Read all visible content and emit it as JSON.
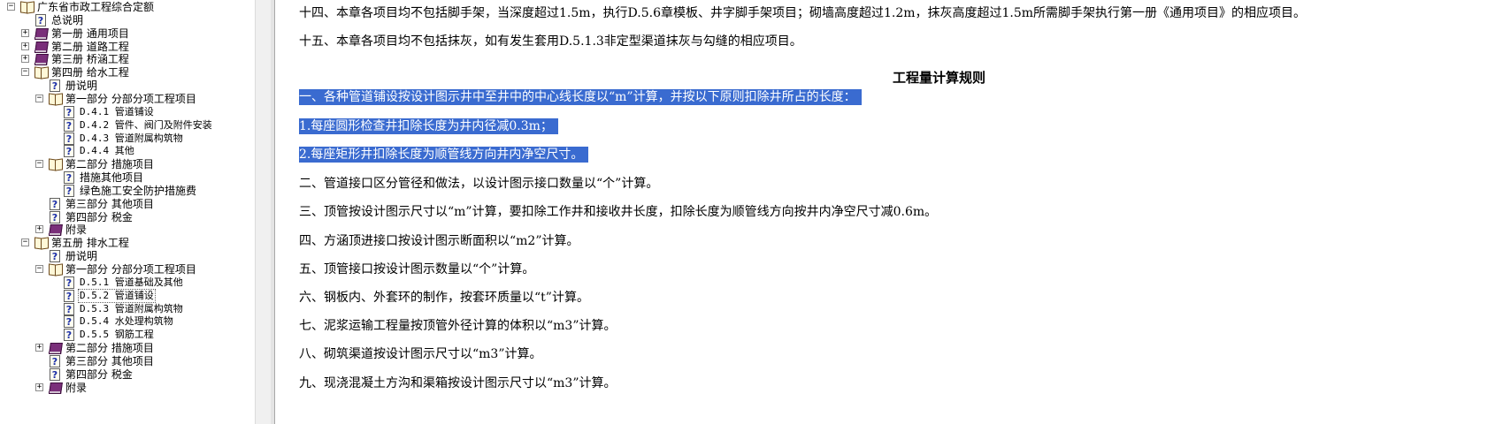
{
  "tree": {
    "items": [
      {
        "label": "广东省市政工程综合定额",
        "icon": "book-open-icon",
        "level": 0,
        "expander": "minus"
      },
      {
        "label": "总说明",
        "icon": "help-page-icon",
        "level": 1,
        "expander": ""
      },
      {
        "label": "第一册 通用项目",
        "icon": "book-closed-icon",
        "level": 1,
        "expander": "plus"
      },
      {
        "label": "第二册 道路工程",
        "icon": "book-closed-icon",
        "level": 1,
        "expander": "plus"
      },
      {
        "label": "第三册 桥涵工程",
        "icon": "book-closed-icon",
        "level": 1,
        "expander": "plus"
      },
      {
        "label": "第四册 给水工程",
        "icon": "book-open-icon",
        "level": 1,
        "expander": "minus"
      },
      {
        "label": "册说明",
        "icon": "help-page-icon",
        "level": 2,
        "expander": ""
      },
      {
        "label": "第一部分 分部分项工程项目",
        "icon": "book-open-icon",
        "level": 2,
        "expander": "minus"
      },
      {
        "label": "D.4.1 管道铺设",
        "icon": "help-page-icon",
        "level": 3,
        "expander": ""
      },
      {
        "label": "D.4.2 管件、阀门及附件安装",
        "icon": "help-page-icon",
        "level": 3,
        "expander": ""
      },
      {
        "label": "D.4.3 管道附属构筑物",
        "icon": "help-page-icon",
        "level": 3,
        "expander": ""
      },
      {
        "label": "D.4.4 其他",
        "icon": "help-page-icon",
        "level": 3,
        "expander": ""
      },
      {
        "label": "第二部分 措施项目",
        "icon": "book-open-icon",
        "level": 2,
        "expander": "minus"
      },
      {
        "label": "措施其他项目",
        "icon": "help-page-icon",
        "level": 3,
        "expander": ""
      },
      {
        "label": "绿色施工安全防护措施费",
        "icon": "help-page-icon",
        "level": 3,
        "expander": ""
      },
      {
        "label": "第三部分 其他项目",
        "icon": "help-page-icon",
        "level": 2,
        "expander": ""
      },
      {
        "label": "第四部分 税金",
        "icon": "help-page-icon",
        "level": 2,
        "expander": ""
      },
      {
        "label": "附录",
        "icon": "book-closed-icon",
        "level": 2,
        "expander": "plus"
      },
      {
        "label": "第五册 排水工程",
        "icon": "book-open-icon",
        "level": 1,
        "expander": "minus"
      },
      {
        "label": "册说明",
        "icon": "help-page-icon",
        "level": 2,
        "expander": ""
      },
      {
        "label": "第一部分 分部分项工程项目",
        "icon": "book-open-icon",
        "level": 2,
        "expander": "minus"
      },
      {
        "label": "D.5.1 管道基础及其他",
        "icon": "help-page-icon",
        "level": 3,
        "expander": ""
      },
      {
        "label": "D.5.2 管道铺设",
        "icon": "help-page-icon",
        "level": 3,
        "expander": "",
        "selected": true
      },
      {
        "label": "D.5.3 管道附属构筑物",
        "icon": "help-page-icon",
        "level": 3,
        "expander": ""
      },
      {
        "label": "D.5.4 水处理构筑物",
        "icon": "help-page-icon",
        "level": 3,
        "expander": ""
      },
      {
        "label": "D.5.5 钢筋工程",
        "icon": "help-page-icon",
        "level": 3,
        "expander": ""
      },
      {
        "label": "第二部分 措施项目",
        "icon": "book-closed-icon",
        "level": 2,
        "expander": "plus"
      },
      {
        "label": "第三部分 其他项目",
        "icon": "help-page-icon",
        "level": 2,
        "expander": ""
      },
      {
        "label": "第四部分 税金",
        "icon": "help-page-icon",
        "level": 2,
        "expander": ""
      },
      {
        "label": "附录",
        "icon": "book-closed-icon",
        "level": 2,
        "expander": "plus"
      }
    ]
  },
  "content": {
    "heading": "工程量计算规则",
    "paragraphs": [
      {
        "text": "十四、本章各项目均不包括脚手架，当深度超过1.5m，执行D.5.6章模板、井字脚手架项目；砌墙高度超过1.2m，抹灰高度超过1.5m所需脚手架执行第一册《通用项目》的相应项目。",
        "highlight": false
      },
      {
        "text": "十五、本章各项目均不包括抹灰，如有发生套用D.5.1.3非定型渠道抹灰与勾缝的相应项目。",
        "highlight": false
      },
      {
        "text": "一、各种管道铺设按设计图示井中至井中的中心线长度以“m”计算，并按以下原则扣除井所占的长度：",
        "highlight": true
      },
      {
        "text": "1.每座圆形检查井扣除长度为井内径减0.3m；",
        "highlight": true
      },
      {
        "text": "2.每座矩形井扣除长度为顺管线方向井内净空尺寸。",
        "highlight": true
      },
      {
        "text": "二、管道接口区分管径和做法，以设计图示接口数量以“个”计算。",
        "highlight": false
      },
      {
        "text": "三、顶管按设计图示尺寸以“m”计算，要扣除工作井和接收井长度，扣除长度为顺管线方向按井内净空尺寸减0.6m。",
        "highlight": false
      },
      {
        "text": "四、方涵顶进接口按设计图示断面积以“m2”计算。",
        "highlight": false
      },
      {
        "text": "五、顶管接口按设计图示数量以“个”计算。",
        "highlight": false
      },
      {
        "text": "六、钢板内、外套环的制作，按套环质量以“t”计算。",
        "highlight": false
      },
      {
        "text": "七、泥浆运输工程量按顶管外径计算的体积以“m3”计算。",
        "highlight": false
      },
      {
        "text": "八、砌筑渠道按设计图示尺寸以“m3”计算。",
        "highlight": false
      },
      {
        "text": "九、现浇混凝土方沟和渠箱按设计图示尺寸以“m3”计算。",
        "highlight": false
      }
    ]
  },
  "colors": {
    "selection_highlight": "#3a6bd0",
    "selection_text": "#ffffff",
    "closed_book": "#7a2f7a"
  }
}
